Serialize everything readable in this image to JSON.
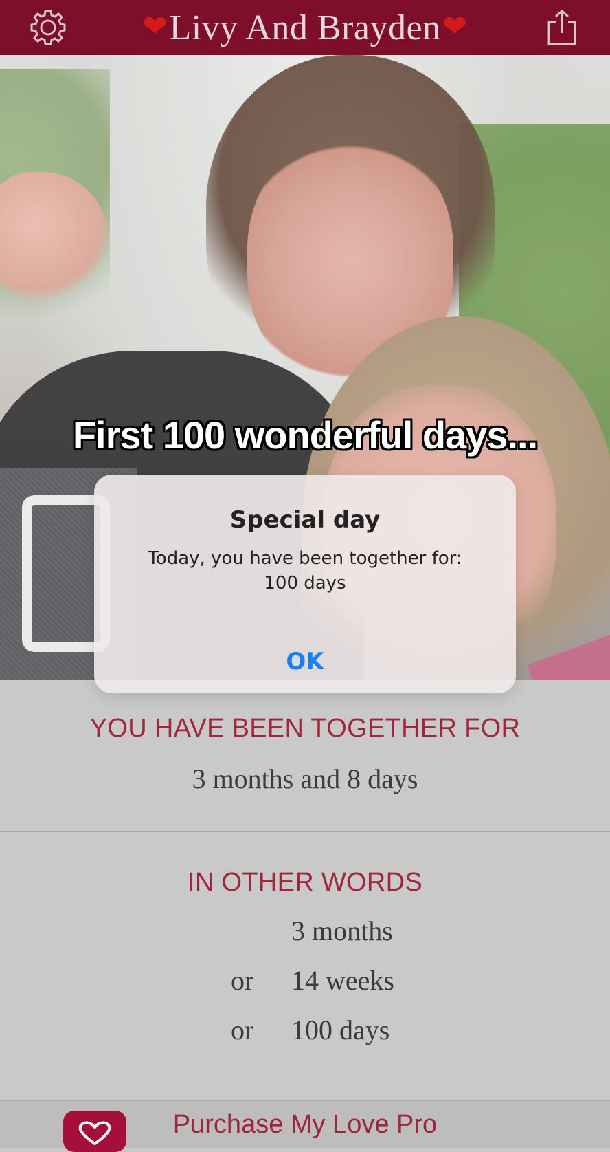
{
  "header": {
    "title": "Livy And Brayden",
    "heart_glyph": "❤",
    "settings_icon": "gear-icon",
    "share_icon": "share-icon"
  },
  "photo": {
    "caption": "First 100 wonderful days..."
  },
  "alert": {
    "title": "Special day",
    "message_line1": "Today, you have been together for:",
    "message_line2": "100 days",
    "ok_label": "OK",
    "ok_color": "#1a7ef5"
  },
  "together": {
    "heading": "YOU HAVE BEEN TOGETHER FOR",
    "value": "3 months and 8 days"
  },
  "other_words": {
    "heading": "IN OTHER WORDS",
    "rows": [
      {
        "prefix": "",
        "value": "3 months"
      },
      {
        "prefix": "or",
        "value": "14 weeks"
      },
      {
        "prefix": "or",
        "value": "100 days"
      }
    ]
  },
  "bottom": {
    "purchase_label": "Purchase My Love Pro",
    "icon": "heart-icon"
  },
  "colors": {
    "brand": "#7d0f2b",
    "accent_text": "#a0263e",
    "heart": "#d51a1a"
  }
}
